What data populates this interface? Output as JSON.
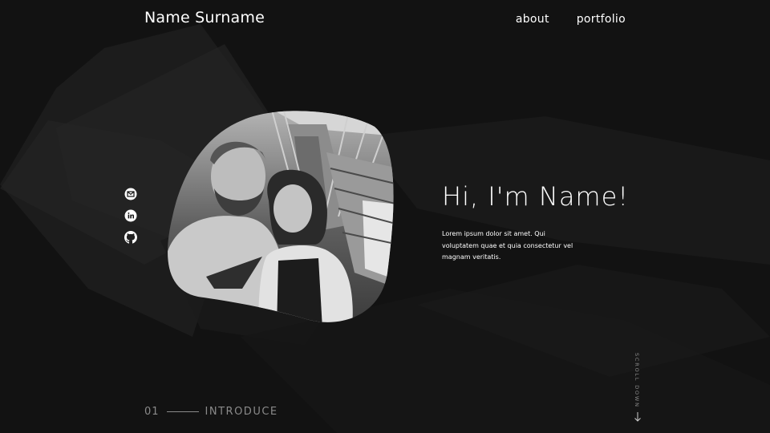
{
  "header": {
    "brand": "Name Surname",
    "nav": [
      {
        "label": "about"
      },
      {
        "label": "portfolio"
      }
    ]
  },
  "social": [
    {
      "icon": "email-icon"
    },
    {
      "icon": "linkedin-icon"
    },
    {
      "icon": "github-icon"
    }
  ],
  "hero": {
    "title": "Hi, I'm Name!",
    "description": "Lorem ipsum dolor sit amet. Qui voluptatem quae et quia consectetur vel magnam veritatis."
  },
  "section": {
    "number": "01",
    "label": "INTRODUCE"
  },
  "scroll": {
    "label": "SCROLL DOWN"
  },
  "colors": {
    "background": "#121212",
    "text": "#ffffff",
    "muted": "#8a8a8a"
  }
}
